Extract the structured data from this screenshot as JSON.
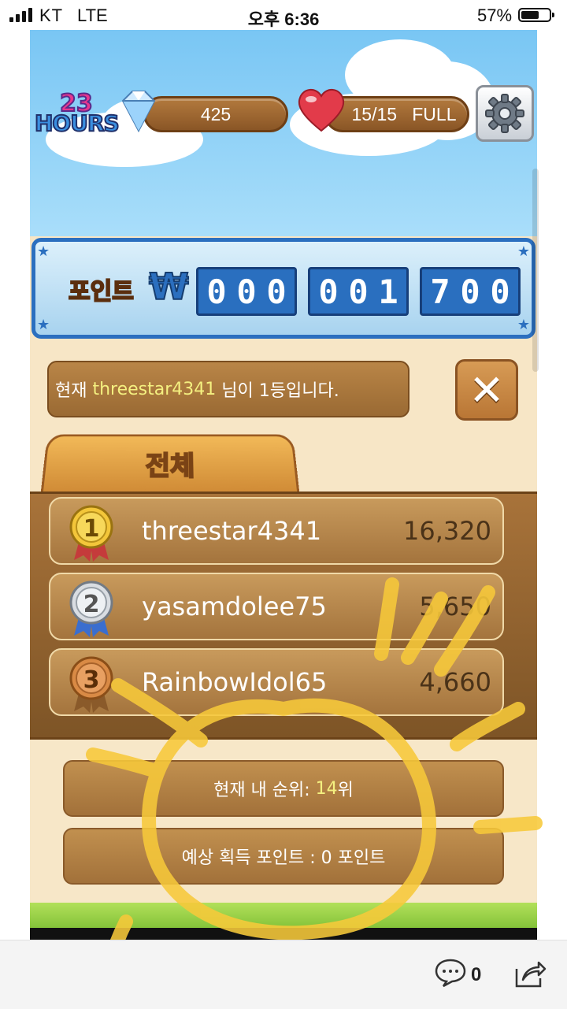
{
  "status_bar": {
    "carrier": "KT",
    "network": "LTE",
    "time": "오후 6:36",
    "battery": "57%"
  },
  "top_bar": {
    "event_logo_number": "23",
    "event_logo_word": "HOURS",
    "gems": "425",
    "hearts": "15/15   FULL"
  },
  "points_board": {
    "label": "포인트",
    "currency_symbol": "₩",
    "digit_groups": [
      [
        "0",
        "0",
        "0"
      ],
      [
        "0",
        "0",
        "1"
      ],
      [
        "7",
        "0",
        "0"
      ]
    ]
  },
  "ranking": {
    "notice_prefix": "현재 ",
    "notice_leader": "threestar4341",
    "notice_suffix": " 님이 1등입니다.",
    "close_symbol": "✕",
    "tab_label": "전체",
    "rows": [
      {
        "rank": "1",
        "name": "threestar4341",
        "score": "16,320"
      },
      {
        "rank": "2",
        "name": "yasamdolee75",
        "score": "5,650"
      },
      {
        "rank": "3",
        "name": "RainbowIdol65",
        "score": "4,660"
      }
    ],
    "my_rank_prefix": "현재 내 순위: ",
    "my_rank_value": "14",
    "my_rank_suffix": "위",
    "expected_points": "예상 획득 포인트 : 0 포인트"
  },
  "toolbar": {
    "comment_count": "0"
  },
  "colors": {
    "sky": "#79c6f4",
    "board_blue": "#2b6fbf",
    "wood": "#a4743d",
    "highlight": "#f4f080",
    "scribble": "#f7c93a"
  }
}
